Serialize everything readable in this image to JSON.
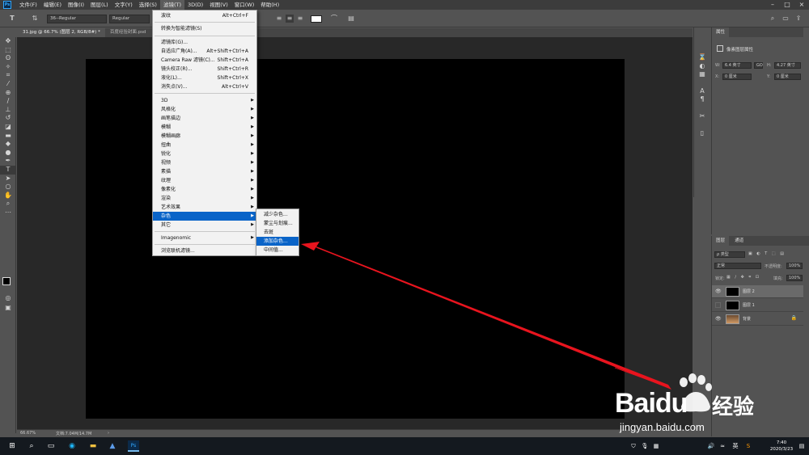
{
  "menubar": {
    "logo": "Ps",
    "items": [
      "文件(F)",
      "编辑(E)",
      "图像(I)",
      "图层(L)",
      "文字(Y)",
      "选择(S)",
      "滤镜(T)",
      "3D(D)",
      "视图(V)",
      "窗口(W)",
      "帮助(H)"
    ],
    "active_index": 6
  },
  "options": {
    "font_family": "36--Regular",
    "font_style": "Regular",
    "text_color": "#ffffff"
  },
  "tabs": [
    {
      "label": "31.jpg @ 66.7% (图层 2, RGB/8#) *",
      "active": true
    },
    {
      "label": "百度经验封面.psd",
      "active": false
    }
  ],
  "filter_menu": {
    "items": [
      {
        "label": "波纹",
        "shortcut": "Alt+Ctrl+F"
      },
      {
        "label": "转换为智能滤镜(S)",
        "shortcut": ""
      },
      {
        "label": "滤镜库(G)...",
        "shortcut": ""
      },
      {
        "label": "自适应广角(A)...",
        "shortcut": "Alt+Shift+Ctrl+A"
      },
      {
        "label": "Camera Raw 滤镜(C)...",
        "shortcut": "Shift+Ctrl+A"
      },
      {
        "label": "镜头校正(R)...",
        "shortcut": "Shift+Ctrl+R"
      },
      {
        "label": "液化(L)...",
        "shortcut": "Shift+Ctrl+X"
      },
      {
        "label": "消失点(V)...",
        "shortcut": "Alt+Ctrl+V"
      },
      {
        "label": "3D"
      },
      {
        "label": "风格化"
      },
      {
        "label": "画笔描边"
      },
      {
        "label": "模糊"
      },
      {
        "label": "模糊画廊"
      },
      {
        "label": "扭曲"
      },
      {
        "label": "锐化"
      },
      {
        "label": "视频"
      },
      {
        "label": "素描"
      },
      {
        "label": "纹理"
      },
      {
        "label": "像素化"
      },
      {
        "label": "渲染"
      },
      {
        "label": "艺术效果"
      },
      {
        "label": "杂色"
      },
      {
        "label": "其它"
      },
      {
        "label": "Imagenomic"
      },
      {
        "label": "浏览联机滤镜..."
      }
    ]
  },
  "noise_submenu": {
    "items": [
      "减少杂色...",
      "蒙尘与划痕...",
      "去斑",
      "添加杂色...",
      "中间值..."
    ],
    "highlighted_index": 3
  },
  "properties": {
    "tabs": [
      "属性"
    ],
    "title": "像素图层属性",
    "w_label": "W:",
    "w_value": "6.4 英寸",
    "h_label": "H:",
    "h_value": "4.27 英寸",
    "x_label": "X:",
    "x_value": "0 厘米",
    "y_label": "Y:",
    "y_value": "0 厘米",
    "link": "GO"
  },
  "layers": {
    "tabs": [
      "图层",
      "通道"
    ],
    "filter": "ρ 类型",
    "blend_mode": "正常",
    "opacity_label": "不透明度:",
    "opacity": "100%",
    "lock_label": "锁定:",
    "fill_label": "填充:",
    "fill": "100%",
    "rows": [
      {
        "name": "图层 2",
        "visible": true,
        "selected": true
      },
      {
        "name": "图层 1",
        "visible": false,
        "selected": false
      },
      {
        "name": "背景",
        "visible": true,
        "selected": false
      }
    ]
  },
  "status": {
    "zoom": "66.67%",
    "doc": "文档:7.04M/14.7M"
  },
  "taskbar": {
    "time": "7:40",
    "date": "2020/3/23"
  },
  "watermark": {
    "brand": "Baidu",
    "jingyan": "经验",
    "url": "jingyan.baidu.com"
  },
  "colors": {
    "highlight": "#0a64c8",
    "arrow": "#e8141e",
    "watermark": "#ffffff"
  }
}
